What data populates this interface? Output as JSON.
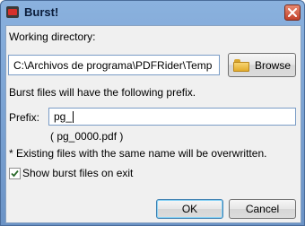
{
  "window": {
    "title": "Burst!"
  },
  "working_directory": {
    "label": "Working directory:",
    "value": "C:\\Archivos de programa\\PDFRider\\Temp",
    "browse_label": "Browse"
  },
  "prefix_info": "Burst files will have the following prefix.",
  "prefix": {
    "label": "Prefix:",
    "value": "pg_",
    "example": "( pg_0000.pdf )"
  },
  "overwrite_note": "* Existing files with the same name will be overwritten.",
  "show_files": {
    "label": "Show burst files on exit",
    "checked": true
  },
  "buttons": {
    "ok": "OK",
    "cancel": "Cancel"
  },
  "icons": [
    "app-icon",
    "close-icon",
    "folder-icon",
    "checkmark-icon"
  ]
}
